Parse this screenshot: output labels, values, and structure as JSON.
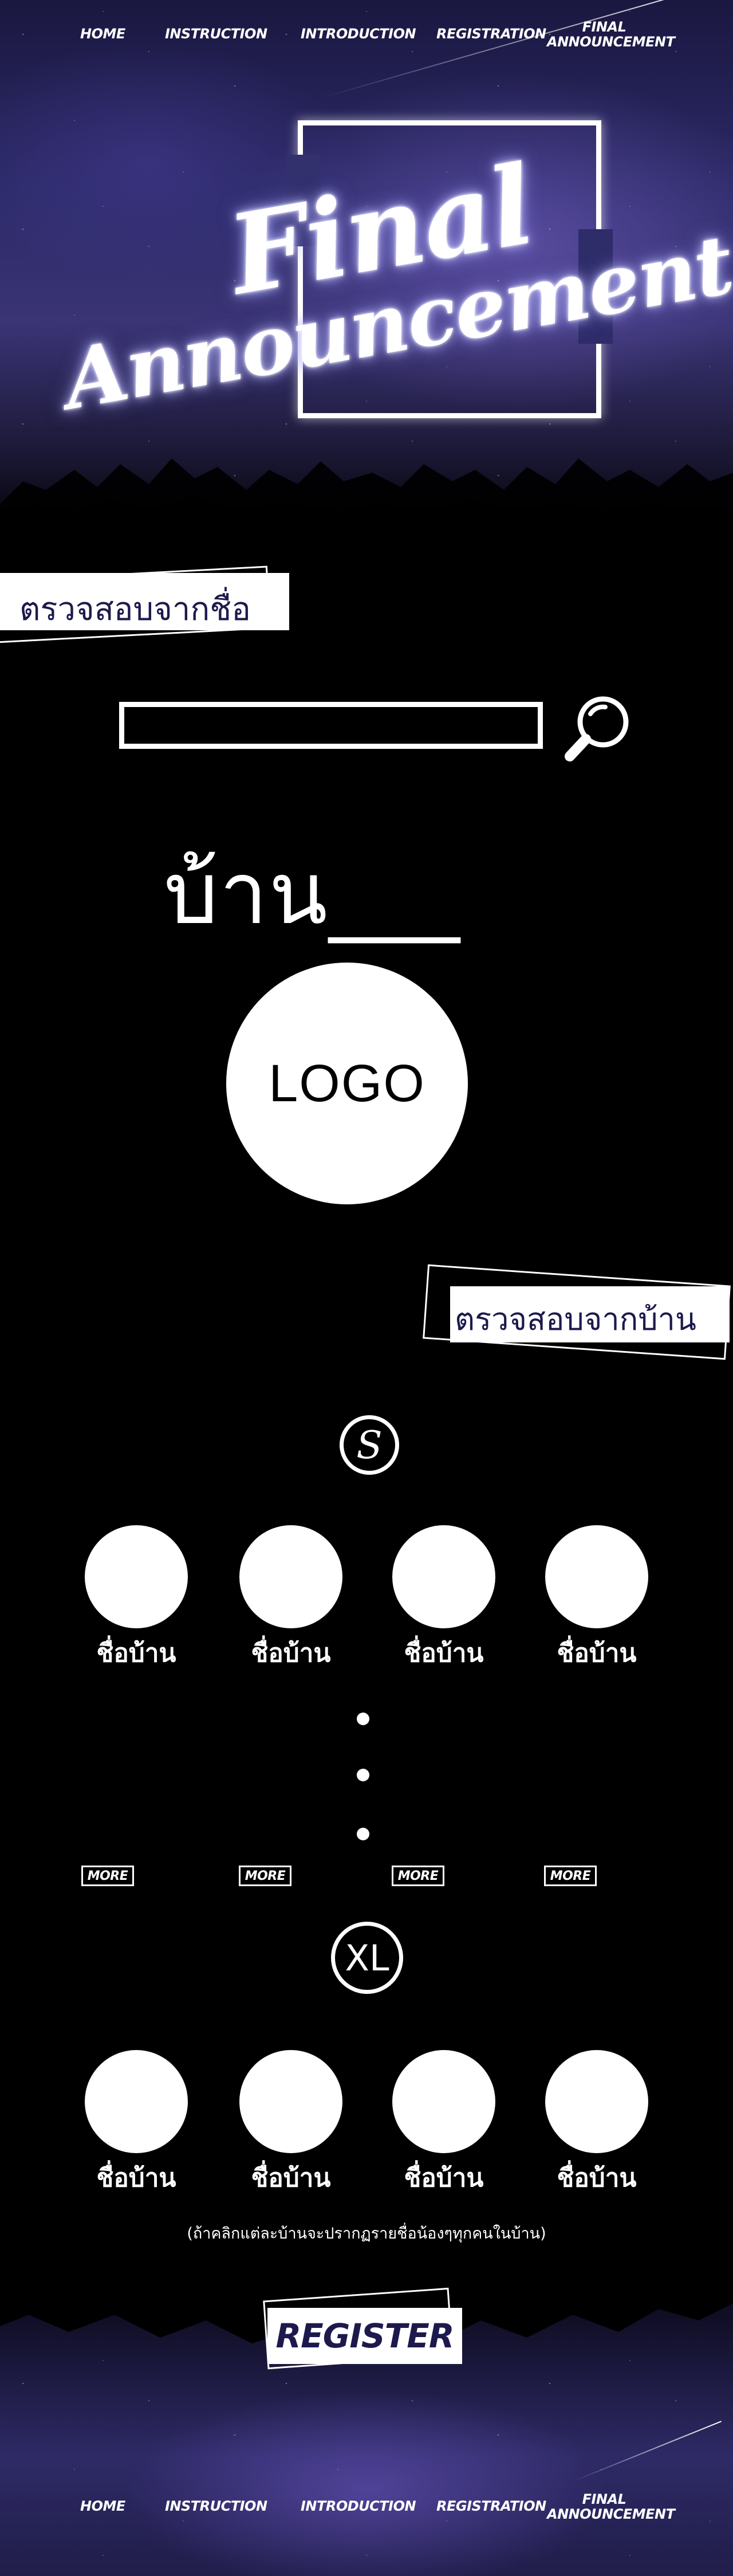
{
  "nav": {
    "items": [
      "HOME",
      "INSTRUCTION",
      "INTRODUCTION",
      "REGISTRATION",
      "FINAL\nANNOUNCEMENT"
    ]
  },
  "hero": {
    "line1": "Final",
    "line2": "Announcement"
  },
  "search_by_name": {
    "label": "ตรวจสอบจากชื่อ",
    "input_value": ""
  },
  "house_result": {
    "title": "บ้าน___",
    "logo_text": "LOGO"
  },
  "search_by_house": {
    "label": "ตรวจสอบจากบ้าน"
  },
  "size_s": {
    "icon_letter": "S",
    "houses": [
      "ชื่อบ้าน",
      "ชื่อบ้าน",
      "ชื่อบ้าน",
      "ชื่อบ้าน"
    ]
  },
  "more_buttons": [
    "MORE",
    "MORE",
    "MORE",
    "MORE"
  ],
  "size_xl": {
    "icon_letter": "XL",
    "houses": [
      "ชื่อบ้าน",
      "ชื่อบ้าน",
      "ชื่อบ้าน",
      "ชื่อบ้าน"
    ]
  },
  "note": "(ถ้าคลิกแต่ละบ้านจะปรากฏรายชื่อน้องๆทุกคนในบ้าน)",
  "register_label": "REGISTER",
  "colors": {
    "badge_text": "#1c1a4d",
    "background": "#000000",
    "sky": "#2c2a68"
  }
}
